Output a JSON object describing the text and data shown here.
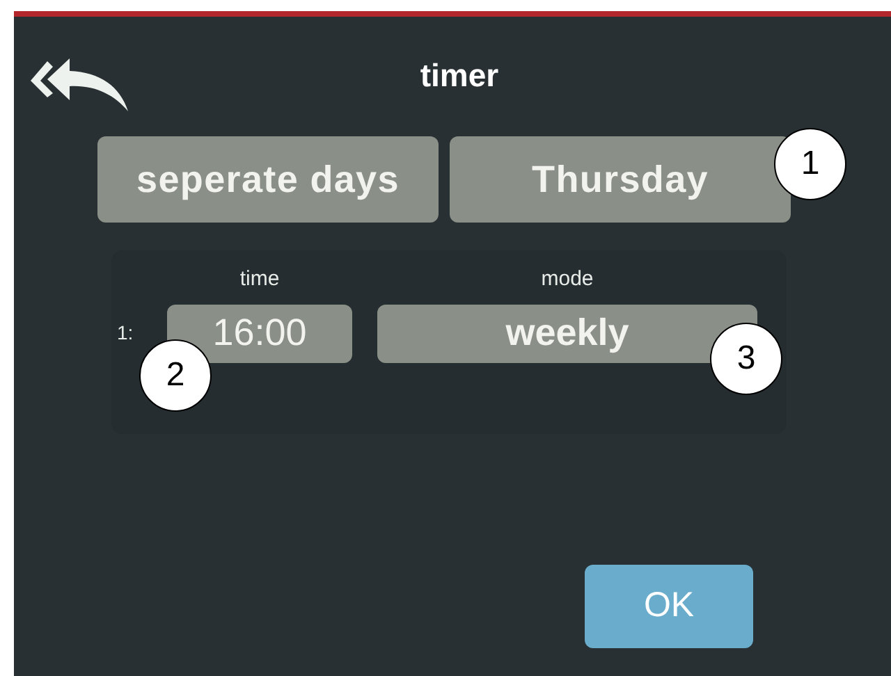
{
  "header": {
    "title": "timer"
  },
  "selectors": [
    {
      "label": "seperate days"
    },
    {
      "label": "Thursday"
    }
  ],
  "schedule": {
    "time_heading": "time",
    "mode_heading": "mode",
    "rows": [
      {
        "index": "1:",
        "time": "16:00",
        "mode": "weekly"
      }
    ]
  },
  "ok_button": {
    "label": "OK"
  },
  "callouts": [
    {
      "label": "1"
    },
    {
      "label": "2"
    },
    {
      "label": "3"
    }
  ]
}
